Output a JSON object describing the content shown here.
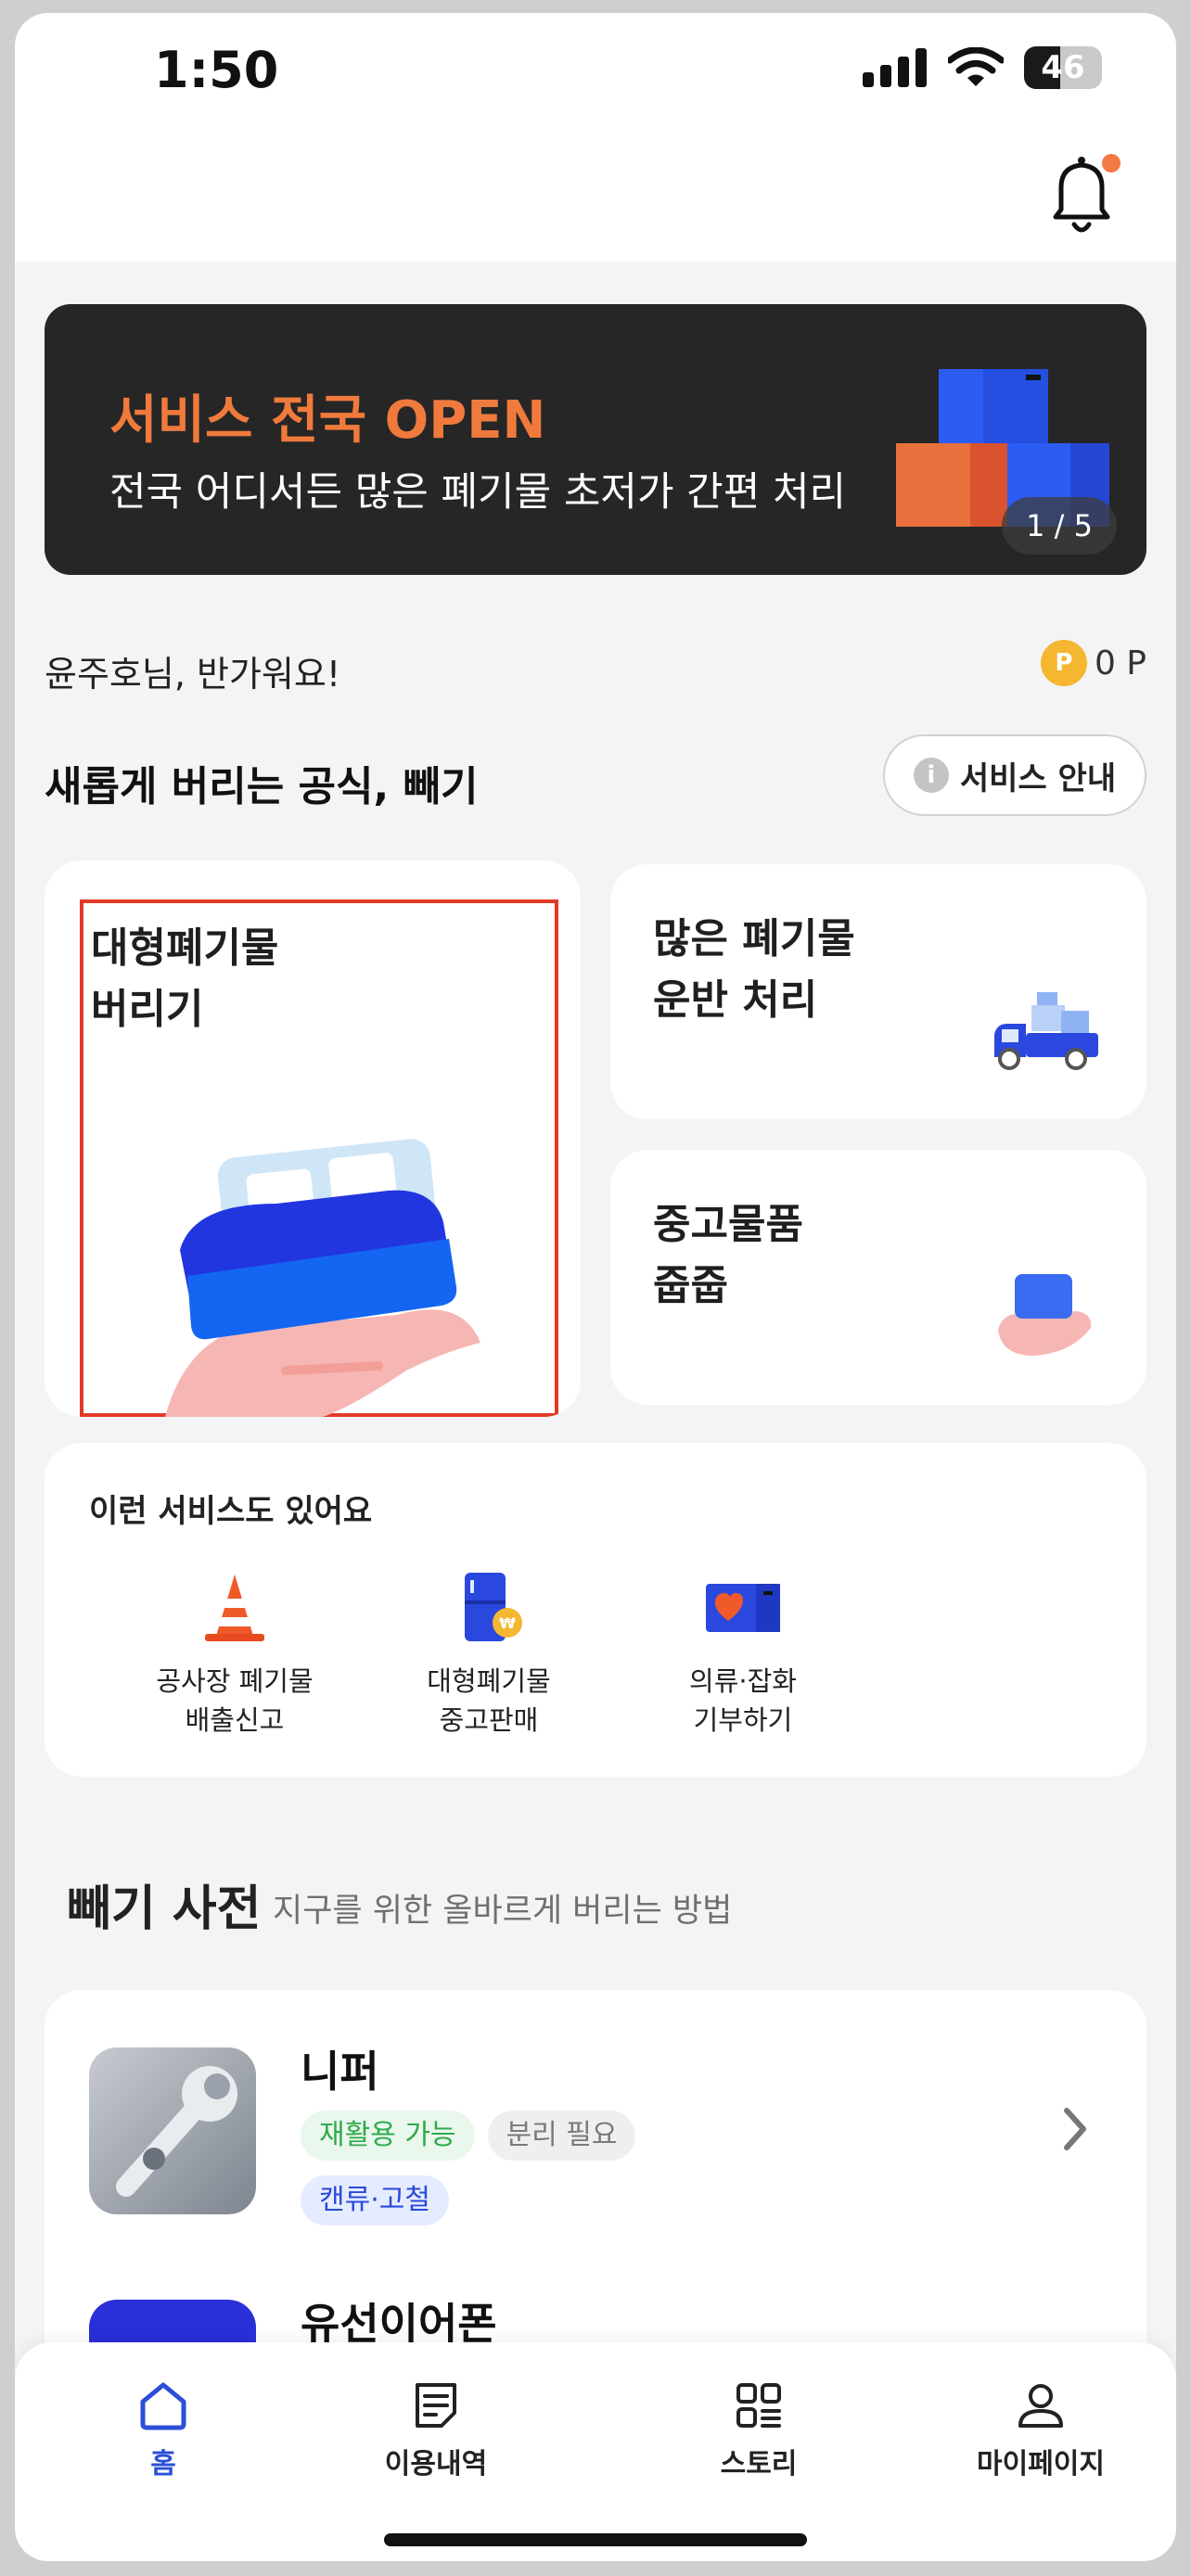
{
  "status_bar": {
    "time": "1:50",
    "battery": "46"
  },
  "banner": {
    "title": "서비스 전국 OPEN",
    "subtitle": "전국 어디서든 많은 폐기물 초저가 간편 처리",
    "pager": "1 / 5",
    "accent_color": "#f07a3c"
  },
  "greeting": "윤주호님, 반가워요!",
  "points": {
    "coin_label": "P",
    "value": "0 P"
  },
  "section": {
    "title": "새롭게 버리는 공식, 빼기",
    "guide_button": "서비스 안내",
    "info_glyph": "i"
  },
  "cards": {
    "big": {
      "line1": "대형폐기물",
      "line2": "버리기"
    },
    "small1": {
      "line1": "많은 폐기물",
      "line2": "운반 처리"
    },
    "small2": {
      "line1": "중고물품",
      "line2": "줍줍"
    }
  },
  "services": {
    "title": "이런 서비스도 있어요",
    "items": [
      {
        "line1": "공사장 폐기물",
        "line2": "배출신고",
        "icon": "traffic-cone-icon"
      },
      {
        "line1": "대형폐기물",
        "line2": "중고판매",
        "icon": "fridge-coin-icon"
      },
      {
        "line1": "의류·잡화",
        "line2": "기부하기",
        "icon": "donation-box-icon"
      }
    ]
  },
  "dictionary": {
    "title": "빼기 사전",
    "subtitle": "지구를 위한 올바르게 버리는 방법",
    "items": [
      {
        "name": "니퍼",
        "tags": [
          "재활용 가능",
          "분리 필요",
          "캔류·고철"
        ]
      },
      {
        "name": "유선이어폰"
      }
    ]
  },
  "tabbar": {
    "items": [
      "홈",
      "이용내역",
      "스토리",
      "마이페이지"
    ],
    "active_color": "#2a4fd8"
  }
}
